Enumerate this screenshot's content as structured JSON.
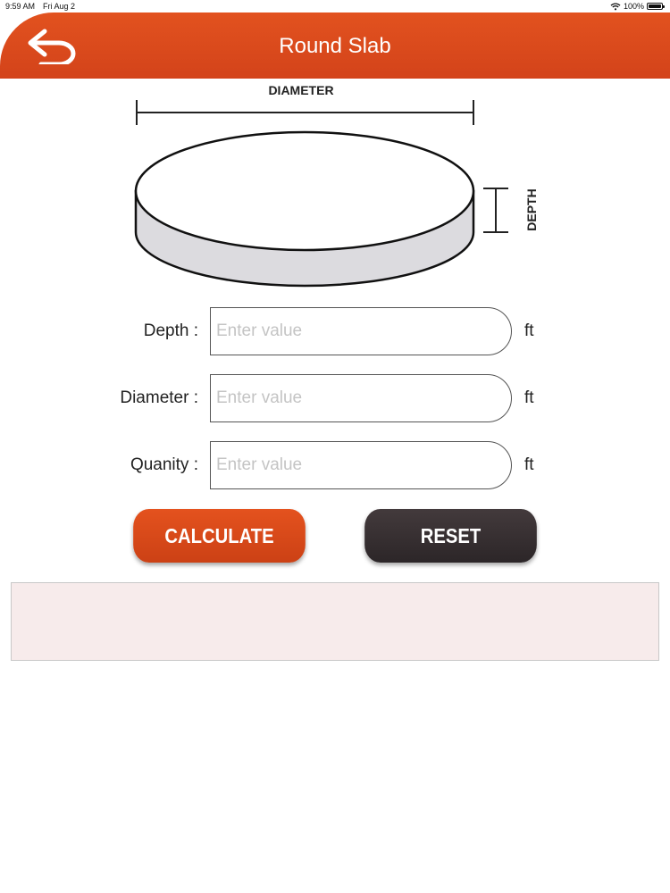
{
  "status": {
    "time": "9:59 AM",
    "date": "Fri Aug 2",
    "battery": "100%",
    "battery_level": 1.0
  },
  "header": {
    "title": "Round Slab",
    "back_icon": "back-arrow-icon"
  },
  "diagram": {
    "diameter_label": "DIAMETER",
    "depth_label": "DEPTH"
  },
  "form": {
    "depth": {
      "label": "Depth :",
      "value": "",
      "placeholder": "Enter value",
      "unit": "ft"
    },
    "diameter": {
      "label": "Diameter :",
      "value": "",
      "placeholder": "Enter value",
      "unit": "ft"
    },
    "quantity": {
      "label": "Quanity :",
      "value": "",
      "placeholder": "Enter value",
      "unit": "ft"
    }
  },
  "buttons": {
    "calculate": "CALCULATE",
    "reset": "RESET"
  },
  "result": {
    "text": ""
  },
  "colors": {
    "accent": "#d94a1c",
    "dark": "#383133",
    "result_bg": "#f7ebeb"
  }
}
